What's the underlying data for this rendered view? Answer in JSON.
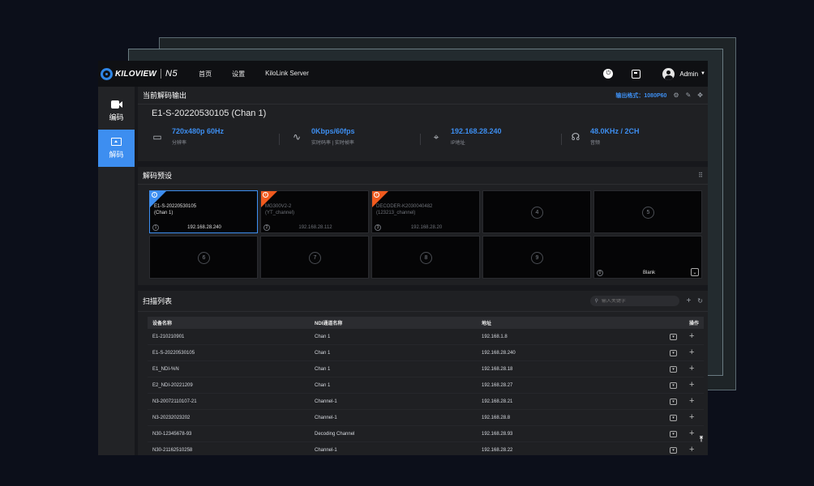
{
  "header": {
    "brand": "KILOVIEW",
    "model": "N5",
    "nav": [
      "首页",
      "设置",
      "KiloLink Server"
    ],
    "user": "Admin"
  },
  "sidebar": {
    "items": [
      {
        "label": "编码",
        "icon": "camera-icon"
      },
      {
        "label": "解码",
        "icon": "monitor-icon",
        "active": true
      }
    ]
  },
  "current": {
    "heading": "当前解码输出",
    "format_label": "输出格式：1080P60",
    "source_title": "E1-S-20220530105 (Chan 1)",
    "stats": [
      {
        "value": "720x480p 60Hz",
        "label": "分辨率",
        "icon": "display-icon"
      },
      {
        "value": "0Kbps/60fps",
        "label": "实时码率 | 实时帧率",
        "icon": "pulse-icon"
      },
      {
        "value": "192.168.28.240",
        "label": "IP地址",
        "icon": "location-icon"
      },
      {
        "value": "48.0KHz / 2CH",
        "label": "音频",
        "icon": "headphone-icon"
      }
    ]
  },
  "presets": {
    "heading": "解码预设",
    "tiles": [
      {
        "num": "1",
        "name1": "E1-S-20220530105",
        "name2": "(Chan 1)",
        "ip": "192.168.28.240",
        "corner": "blue",
        "selected": true
      },
      {
        "num": "2",
        "name1": "MG300V2-2",
        "name2": "(YT_channel)",
        "ip": "192.168.28.112",
        "corner": "orange"
      },
      {
        "num": "3",
        "name1": "DECODER-K2030040482",
        "name2": "(123213_channel)",
        "ip": "192.168.28.20",
        "corner": "orange"
      },
      {
        "center": "4"
      },
      {
        "center": "5"
      },
      {
        "center": "6"
      },
      {
        "center": "7"
      },
      {
        "center": "8"
      },
      {
        "center": "9"
      },
      {
        "num": "0",
        "blank": "Blank"
      }
    ]
  },
  "scan": {
    "heading": "扫描列表",
    "search_placeholder": "输入关键字",
    "columns": [
      "设备名称",
      "NDI通道名称",
      "地址",
      "操作"
    ],
    "rows": [
      [
        "E1-210210901",
        "Chan 1",
        "192.168.1.8"
      ],
      [
        "E1-S-20220530105",
        "Chan 1",
        "192.168.28.240"
      ],
      [
        "E1_NDI-%N",
        "Chan 1",
        "192.168.28.18"
      ],
      [
        "E2_NDI-20221209",
        "Chan 1",
        "192.168.28.27"
      ],
      [
        "N3-20072110107-21",
        "Channel-1",
        "192.168.28.21"
      ],
      [
        "N3-20232023202",
        "Channel-1",
        "192.168.28.8"
      ],
      [
        "N30-12345678-93",
        "Decoding Channel",
        "192.168.28.93"
      ],
      [
        "N30-21162510258",
        "Channel-1",
        "192.168.28.22"
      ]
    ]
  }
}
